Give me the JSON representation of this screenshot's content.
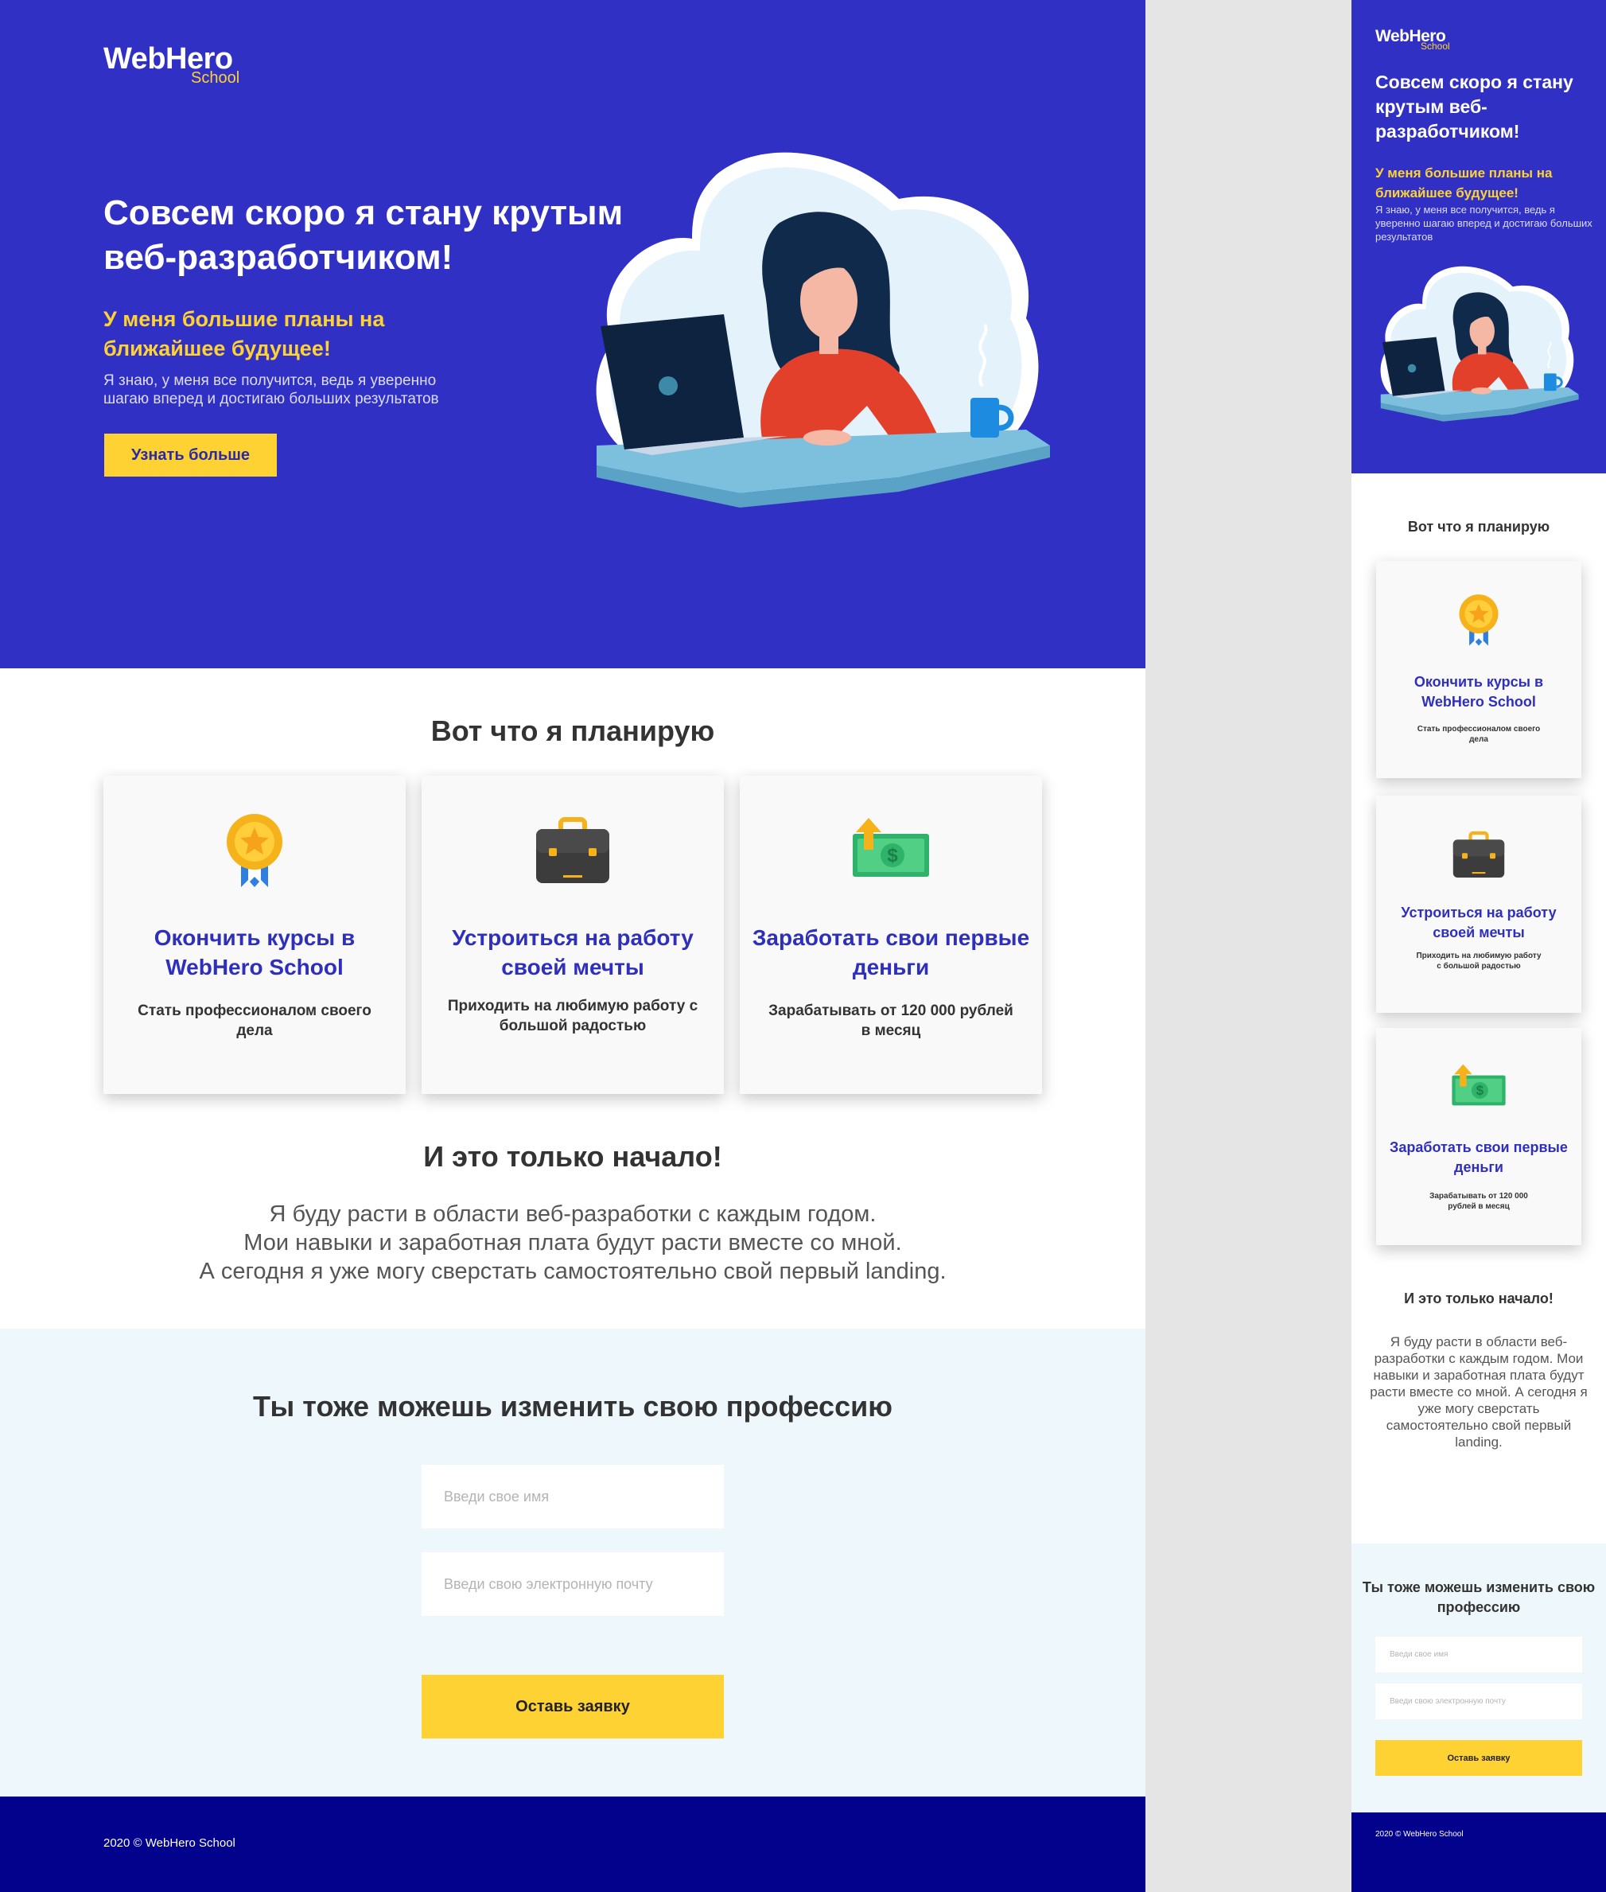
{
  "logo": {
    "main": "WebHero",
    "sub": "School"
  },
  "hero": {
    "title": "Совсем скоро я стану крутым веб-разработчиком!",
    "subtitle": "У меня большие планы на ближайшее будущее!",
    "text": "Я знаю, у меня все получится, ведь я уверенно шагаю вперед и достигаю больших результатов",
    "button": "Узнать больше"
  },
  "plans": {
    "title": "Вот что я планирую",
    "cards": [
      {
        "icon": "medal-icon",
        "title": "Окончить курсы в WebHero School",
        "text": "Стать профессионалом своего дела"
      },
      {
        "icon": "briefcase-icon",
        "title": "Устроиться на работу своей мечты",
        "text": "Приходить на любимую работу с большой радостью"
      },
      {
        "icon": "money-icon",
        "title": "Заработать свои первые деньги",
        "text": "Зарабатывать от 120 000 рублей в месяц"
      }
    ]
  },
  "beginning": {
    "title": "И это только начало!",
    "lines": [
      "Я буду расти в области веб-разработки с каждым годом.",
      "Мои навыки и заработная плата будут расти вместе со мной.",
      "А сегодня я уже могу сверстать самостоятельно свой первый landing."
    ]
  },
  "form": {
    "title": "Ты тоже можешь изменить свою профессию",
    "name_placeholder": "Введи свое имя",
    "email_placeholder": "Введи свою электронную почту",
    "submit": "Оставь заявку"
  },
  "footer": {
    "text": "2020  © WebHero School"
  },
  "colors": {
    "primary": "#3030c4",
    "accent": "#ffd234",
    "footer": "#02028c",
    "form_bg": "#eef8fc"
  }
}
